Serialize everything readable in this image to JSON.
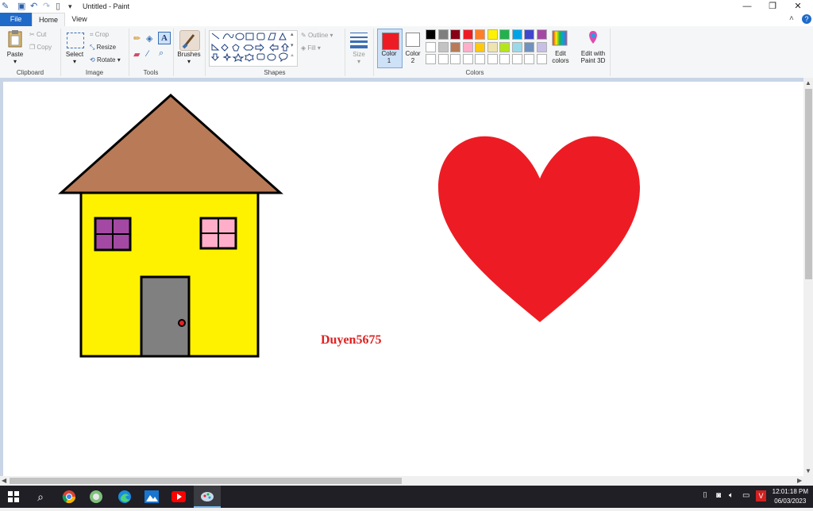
{
  "window": {
    "title": "Untitled - Paint",
    "minimize_glyph": "—",
    "restore_glyph": "❐",
    "close_glyph": "✕"
  },
  "quick_access": {
    "app_icon": "paint-icon",
    "save_icon": "save-icon",
    "undo_icon": "undo-icon",
    "redo_icon": "redo-icon",
    "new_icon": "new-file-icon",
    "customize_icon": "dropdown-icon"
  },
  "tabs": {
    "file": "File",
    "home": "Home",
    "view": "View"
  },
  "ribbon": {
    "clipboard": {
      "label": "Clipboard",
      "paste": "Paste",
      "cut": "Cut",
      "copy": "Copy"
    },
    "image": {
      "label": "Image",
      "select": "Select",
      "crop": "Crop",
      "resize": "Resize",
      "rotate": "Rotate"
    },
    "tools": {
      "label": "Tools"
    },
    "brushes": {
      "label": "Brushes"
    },
    "shapes": {
      "label": "Shapes",
      "outline": "Outline",
      "fill": "Fill"
    },
    "size": {
      "label": "Size"
    },
    "colors": {
      "label": "Colors",
      "color1": "Color",
      "color1_num": "1",
      "color2": "Color",
      "color2_num": "2",
      "edit_colors_1": "Edit",
      "edit_colors_2": "colors",
      "paint3d_1": "Edit with",
      "paint3d_2": "Paint 3D",
      "color1_value": "#ed1c24",
      "color2_value": "#ffffff",
      "palette_row1": [
        "#000000",
        "#7f7f7f",
        "#880015",
        "#ed1c24",
        "#ff7f27",
        "#fff200",
        "#22b14c",
        "#00a2e8",
        "#3f48cc",
        "#a349a4"
      ],
      "palette_row2": [
        "#ffffff",
        "#c3c3c3",
        "#b97a57",
        "#ffaec9",
        "#ffc90e",
        "#efe4b0",
        "#b5e61d",
        "#99d9ea",
        "#7092be",
        "#c8bfe7"
      ]
    }
  },
  "canvas": {
    "text_label": "Duyen5675",
    "text_color": "#e02020",
    "roof_color": "#b97a57",
    "wall_color": "#fff200",
    "window_left_color": "#a349a4",
    "window_right_color": "#ffaec9",
    "door_color": "#808080",
    "heart_color": "#ed1c24"
  },
  "taskbar": {
    "start_icon": "windows-start-icon",
    "search_icon": "search-icon",
    "apps": [
      "chrome-icon",
      "paint-net-icon",
      "edge-icon",
      "photos-icon",
      "youtube-icon",
      "paint-app-icon"
    ],
    "time": "12:01:18 PM",
    "date": "06/03/2023"
  }
}
